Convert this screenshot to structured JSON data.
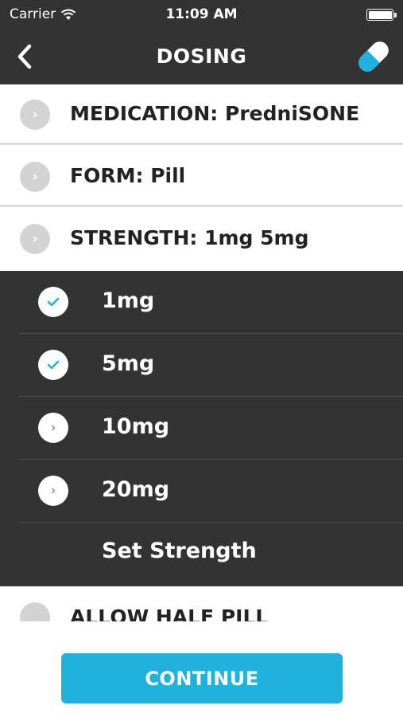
{
  "statusbar": {
    "carrier": "Carrier",
    "time": "11:09 AM"
  },
  "navbar": {
    "title": "DOSING",
    "back_icon": "chevron-left-icon",
    "action_icon": "pill-icon"
  },
  "colors": {
    "dark_bg": "#333333",
    "accent": "#1fb2dd",
    "row_dot": "#d3d3d3"
  },
  "rows": [
    {
      "key": "MEDICATION:",
      "value": "PredniSONE"
    },
    {
      "key": "FORM:",
      "value": "Pill"
    },
    {
      "key": "STRENGTH:",
      "value": "1mg 5mg"
    }
  ],
  "strength_options": [
    {
      "label": "1mg",
      "checked": true
    },
    {
      "label": "5mg",
      "checked": true
    },
    {
      "label": "10mg",
      "checked": false
    },
    {
      "label": "20mg",
      "checked": false
    }
  ],
  "set_strength_label": "Set Strength",
  "partial_row_label": "ALLOW HALF PILL",
  "continue_label": "CONTINUE"
}
